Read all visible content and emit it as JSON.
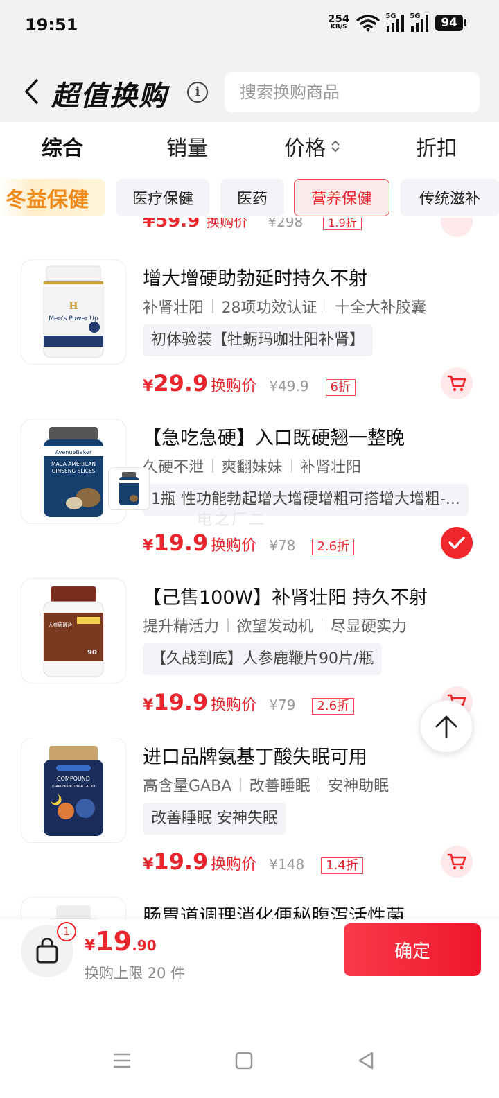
{
  "status_bar": {
    "time": "19:51",
    "net_speed_value": "254",
    "net_speed_unit": "KB/S",
    "network_1": "5G",
    "network_2": "5G",
    "battery": "94"
  },
  "header": {
    "title": "超值换购",
    "search_placeholder": "搜索换购商品"
  },
  "sort_tabs": [
    "综合",
    "销量",
    "价格",
    "折扣"
  ],
  "categories": [
    {
      "label": "冬益保健"
    },
    {
      "label": "医疗保健"
    },
    {
      "label": "医药"
    },
    {
      "label": "营养保健"
    },
    {
      "label": "传统滋补"
    }
  ],
  "partial_top": {
    "price": "¥59.9",
    "label": "换购价",
    "old_price": "¥298",
    "discount": "1.9折"
  },
  "products": [
    {
      "title": "增大增硬助勃延时持久不射",
      "tags": [
        "补肾壮阳",
        "28项功效认证",
        "十全大补胶囊"
      ],
      "subtitle": "初体验装【牡蛎玛咖壮阳补肾】",
      "yen": "¥",
      "price": "29.9",
      "price_label": "换购价",
      "old_price": "¥49.9",
      "discount": "6折",
      "selected": false,
      "bottle_color": "#f4f4f6",
      "cap_color": "#f0f0f0",
      "label_text": "Men's Power Up"
    },
    {
      "title": "【急吃急硬】入口既硬翘一整晚",
      "tags": [
        "久硬不泄",
        "爽翻妹妹",
        "补肾壮阳"
      ],
      "subtitle": "1瓶 性功能勃起增大增硬增粗可搭增大增粗-...",
      "yen": "¥",
      "price": "19.9",
      "price_label": "换购价",
      "old_price": "¥78",
      "discount": "2.6折",
      "selected": true,
      "bottle_color": "#173f6e",
      "cap_color": "#4a4a4a",
      "label_text": "MACA AMERICAN GINSENG SLICES"
    },
    {
      "title": "【己售100W】补肾壮阳 持久不射",
      "tags": [
        "提升精活力",
        "欲望发动机",
        "尽显硬实力"
      ],
      "subtitle": "【久战到底】人参鹿鞭片90片/瓶",
      "yen": "¥",
      "price": "19.9",
      "price_label": "换购价",
      "old_price": "¥79",
      "discount": "2.6折",
      "selected": false,
      "bottle_color": "#f6f6f6",
      "cap_color": "#7a2e1e",
      "label_text": "90"
    },
    {
      "title": "进口品牌氨基丁酸失眠可用",
      "tags": [
        "高含量GABA",
        "改善睡眠",
        "安神助眠"
      ],
      "subtitle": "改善睡眠 安神失眠",
      "yen": "¥",
      "price": "19.9",
      "price_label": "换购价",
      "old_price": "¥148",
      "discount": "1.4折",
      "selected": false,
      "bottle_color": "#1b2d5a",
      "cap_color": "#c9a46a",
      "label_text": "COMPOUND γ-AMINOBUTYRIC ACID"
    },
    {
      "title": "肠胃道调理消化便秘腹泻活性菌"
    }
  ],
  "watermark": "电之厂二",
  "bottom_bar": {
    "badge_count": "1",
    "yen": "¥",
    "total_int": "19",
    "total_dec": ".90",
    "limit_text": "换购上限 20 件",
    "confirm_label": "确定"
  },
  "colors": {
    "accent_red": "#e9262d",
    "promo_orange": "#f08a1a",
    "chip_bg": "#f3f4f7"
  }
}
